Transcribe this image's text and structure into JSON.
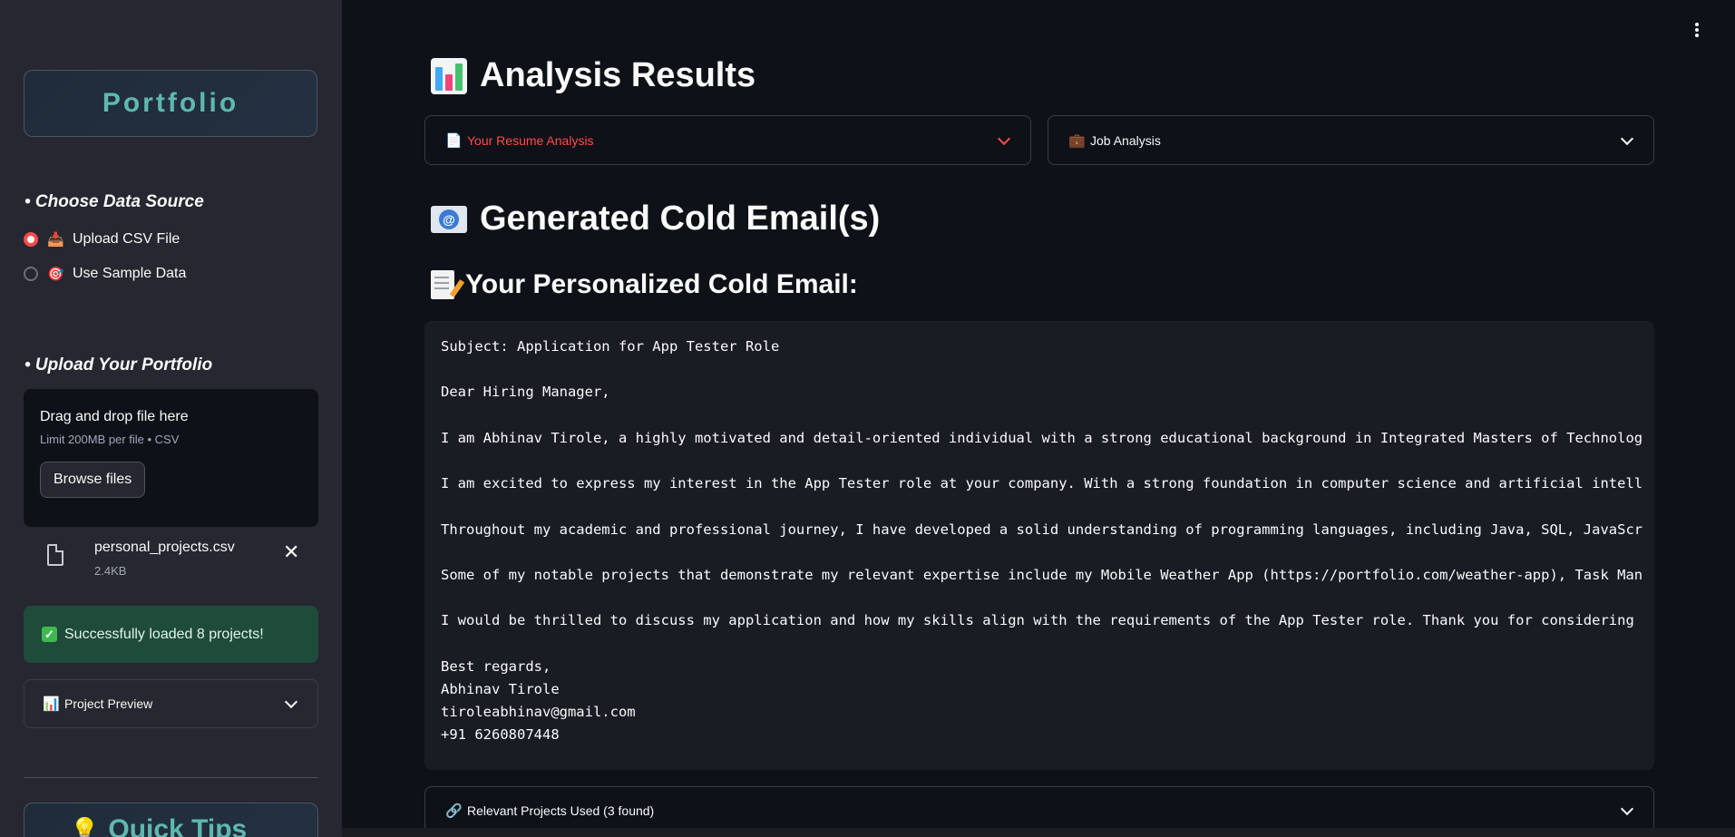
{
  "sidebar": {
    "portfolio_title": "Portfolio",
    "data_source_heading": "• Choose Data Source",
    "data_source_options": [
      {
        "icon": "inbox-tray-icon",
        "label": "Upload CSV File",
        "selected": true
      },
      {
        "icon": "dart-target-icon",
        "label": "Use Sample Data",
        "selected": false
      }
    ],
    "upload_heading": "• Upload Your Portfolio",
    "uploader": {
      "title": "Drag and drop file here",
      "limit": "Limit 200MB per file • CSV",
      "browse_label": "Browse files"
    },
    "uploaded_file": {
      "name": "personal_projects.csv",
      "size": "2.4KB"
    },
    "success_message": "Successfully loaded 8 projects!",
    "project_preview_label": "Project Preview",
    "quick_tips_label": "Quick Tips"
  },
  "main": {
    "analysis_title": "Analysis Results",
    "resume_expander_label": "Your Resume Analysis",
    "job_expander_label": "Job Analysis",
    "emails_title": "Generated Cold Email(s)",
    "personalized_title": "Your Personalized Cold Email:",
    "email_lines": [
      "Subject: Application for App Tester Role",
      "",
      "Dear Hiring Manager,",
      "",
      "I am Abhinav Tirole, a highly motivated and detail-oriented individual with a strong educational background in Integrated Masters of Technolog",
      "",
      "I am excited to express my interest in the App Tester role at your company. With a strong foundation in computer science and artificial intell",
      "",
      "Throughout my academic and professional journey, I have developed a solid understanding of programming languages, including Java, SQL, JavaScr",
      "",
      "Some of my notable projects that demonstrate my relevant expertise include my Mobile Weather App (https://portfolio.com/weather-app), Task Man",
      "",
      "I would be thrilled to discuss my application and how my skills align with the requirements of the App Tester role. Thank you for considering",
      "",
      "Best regards,",
      "Abhinav Tirole",
      "tiroleabhinav@gmail.com",
      "+91 6260807448"
    ],
    "relevant_projects_label": "Relevant Projects Used (3 found)"
  },
  "colors": {
    "accent_red": "#ff4b4b",
    "teal_title": "#5fb8b0",
    "success_bg": "#1f4b3a"
  }
}
